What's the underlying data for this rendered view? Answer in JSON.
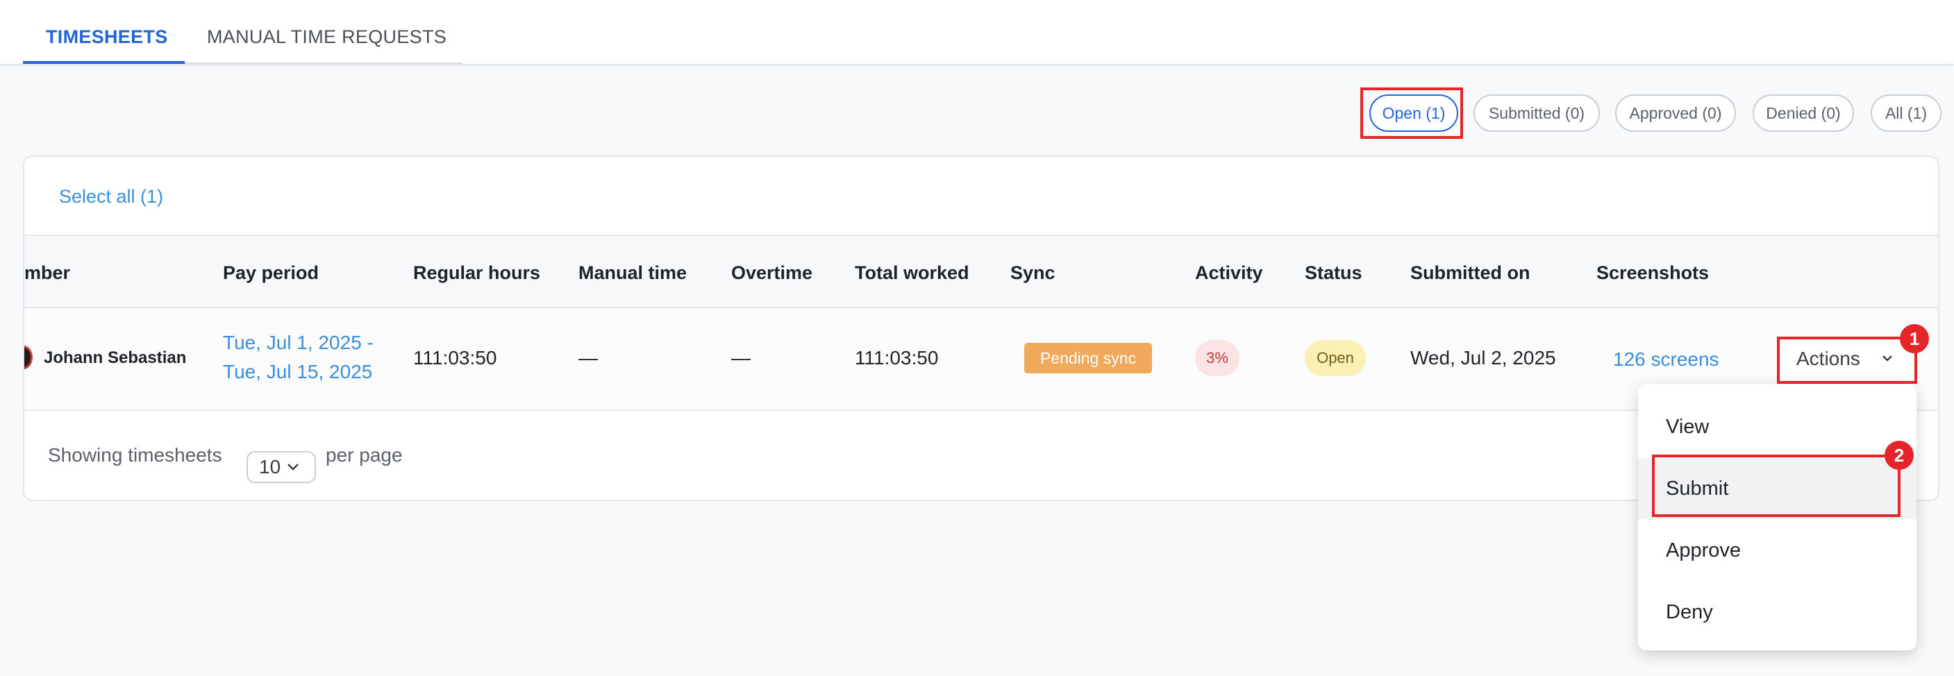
{
  "tabs": [
    {
      "label": "TIMESHEETS",
      "active": true
    },
    {
      "label": "MANUAL TIME REQUESTS",
      "active": false
    }
  ],
  "filters": [
    {
      "label": "Open (1)",
      "active": true
    },
    {
      "label": "Submitted (0)",
      "active": false
    },
    {
      "label": "Approved (0)",
      "active": false
    },
    {
      "label": "Denied (0)",
      "active": false
    },
    {
      "label": "All (1)",
      "active": false
    }
  ],
  "table": {
    "select_all": "Select all (1)",
    "headers": [
      "mber",
      "Pay period",
      "Regular hours",
      "Manual time",
      "Overtime",
      "Total worked",
      "Sync",
      "Activity",
      "Status",
      "Submitted on",
      "Screenshots"
    ],
    "row": {
      "member": "Johann Sebastian",
      "pay_period_line1": "Tue, Jul 1, 2025 -",
      "pay_period_line2": "Tue, Jul 15, 2025",
      "regular_hours": "111:03:50",
      "manual_time": "—",
      "overtime": "—",
      "total_worked": "111:03:50",
      "sync": "Pending sync",
      "activity": "3%",
      "status": "Open",
      "submitted_on": "Wed, Jul 2, 2025",
      "screenshots": "126 screens",
      "actions_label": "Actions"
    }
  },
  "pagination": {
    "showing_label": "Showing timesheets",
    "per_page_value": "10",
    "per_page_suffix": "per page"
  },
  "actions_menu": [
    "View",
    "Submit",
    "Approve",
    "Deny"
  ],
  "annotations": [
    "1",
    "2"
  ],
  "colors": {
    "accent": "#2166d8",
    "link": "#3b8fd9",
    "highlight": "#e5252a",
    "pending_sync": "#f0a95a",
    "status_open": "#fbf0b4",
    "activity_low": "#fbe3e3"
  }
}
